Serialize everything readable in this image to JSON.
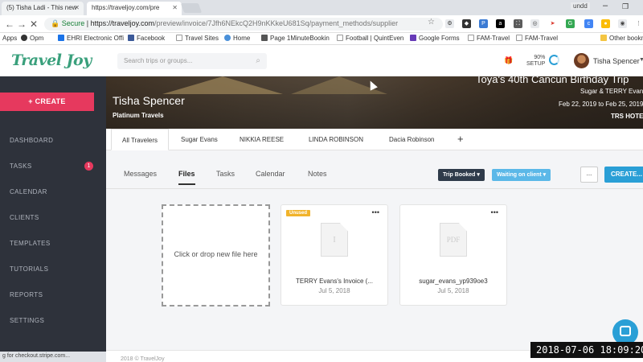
{
  "browser": {
    "tabs": [
      {
        "label": "(5) Tisha Ladi - This new"
      },
      {
        "label": "https://traveljoy.com/pre"
      }
    ],
    "window_label": "undd",
    "url": {
      "secure_label": "Secure",
      "host": "https://traveljoy.com",
      "path": "/preview/invoice/7Jfh6NEkcQ2H9nKKkeU681Sq/payment_methods/supplier"
    },
    "bookmarks": [
      {
        "label": "Apps"
      },
      {
        "label": "Opm"
      },
      {
        "label": "EHRI Electronic Offi"
      },
      {
        "label": "Facebook"
      },
      {
        "label": "Travel Sites"
      },
      {
        "label": "Home"
      },
      {
        "label": "Page 1MinuteBookin"
      },
      {
        "label": "Football | QuintEven"
      },
      {
        "label": "Google Forms"
      },
      {
        "label": "FAM-Travel"
      },
      {
        "label": "FAM-Travel"
      },
      {
        "label": "Other bookm"
      }
    ],
    "status_text": "g for checkout.stripe.com..."
  },
  "header": {
    "logo": "Travel Joy",
    "search_placeholder": "Search trips or groups...",
    "setup_percent": "90%",
    "setup_label": "SETUP",
    "user_name": "Tisha Spencer"
  },
  "sidebar": {
    "create_label": "+ CREATE",
    "items": [
      {
        "label": "DASHBOARD"
      },
      {
        "label": "TASKS",
        "badge": "1"
      },
      {
        "label": "CALENDAR"
      },
      {
        "label": "CLIENTS"
      },
      {
        "label": "TEMPLATES"
      },
      {
        "label": "TUTORIALS"
      },
      {
        "label": "REPORTS"
      },
      {
        "label": "SETTINGS"
      }
    ]
  },
  "hero": {
    "name": "Tisha Spencer",
    "agency": "Platinum Travels",
    "trip_title": "Toya's 40th Cancun Birthday Trip",
    "travelers": "Sugar & TERRY Evans",
    "dates": "Feb 22, 2019 to Feb 25, 2019",
    "hotel": "TRS HOTEL"
  },
  "traveler_tabs": [
    {
      "label": "All Travelers"
    },
    {
      "label": "Sugar Evans"
    },
    {
      "label": "NIKKIA REESE"
    },
    {
      "label": "LINDA ROBINSON"
    },
    {
      "label": "Dacia Robinson"
    }
  ],
  "sub_tabs": [
    {
      "label": "Messages"
    },
    {
      "label": "Files"
    },
    {
      "label": "Tasks"
    },
    {
      "label": "Calendar"
    },
    {
      "label": "Notes"
    }
  ],
  "status": {
    "trip_status": "Trip Booked ▾",
    "client_status": "Waiting on client ▾",
    "more_label": "...",
    "create_label": "CREATE..."
  },
  "files": {
    "drop_label": "Click or drop new file here",
    "items": [
      {
        "badge": "Unused",
        "type_label": "I",
        "name": "TERRY Evans's Invoice (...",
        "date": "Jul 5, 2018"
      },
      {
        "badge": "",
        "type_label": "PDF",
        "name": "sugar_evans_yp939oe3",
        "date": "Jul 5, 2018"
      }
    ]
  },
  "footer": {
    "copyright": "2018 © TravelJoy"
  },
  "recording_timestamp": "2018-07-06 18:09:20",
  "colors": {
    "brand_green": "#3aa07c",
    "create_pink": "#e6395e",
    "sidebar_bg": "#2e323b",
    "accent_blue": "#2a9fd6",
    "trip_booked": "#2f3b4a",
    "waiting_client": "#5bb8e8",
    "unused_badge": "#f1b32b"
  }
}
